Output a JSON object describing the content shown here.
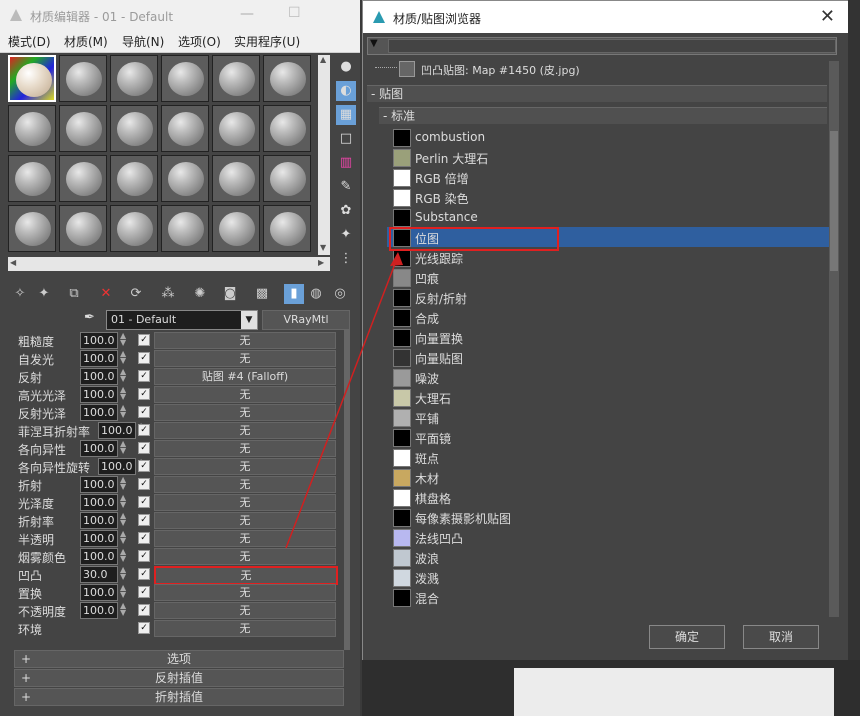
{
  "left_window": {
    "title": "材质编辑器 - 01 - Default",
    "menu": [
      "模式(D)",
      "材质(M)",
      "导航(N)",
      "选项(O)",
      "实用程序(U)"
    ],
    "material_name": "01 - Default",
    "material_type": "VRayMtl",
    "params": [
      {
        "label": "粗糙度",
        "value": "100.0",
        "map": "无"
      },
      {
        "label": "自发光",
        "value": "100.0",
        "map": "无"
      },
      {
        "label": "反射",
        "value": "100.0",
        "map": "贴图 #4 (Falloff)"
      },
      {
        "label": "高光光泽",
        "value": "100.0",
        "map": "无"
      },
      {
        "label": "反射光泽",
        "value": "100.0",
        "map": "无"
      },
      {
        "label": "菲涅耳折射率",
        "value": "100.0",
        "map": "无"
      },
      {
        "label": "各向异性",
        "value": "100.0",
        "map": "无"
      },
      {
        "label": "各向异性旋转",
        "value": "100.0",
        "map": "无"
      },
      {
        "label": "折射",
        "value": "100.0",
        "map": "无"
      },
      {
        "label": "光泽度",
        "value": "100.0",
        "map": "无"
      },
      {
        "label": "折射率",
        "value": "100.0",
        "map": "无"
      },
      {
        "label": "半透明",
        "value": "100.0",
        "map": "无"
      },
      {
        "label": "烟雾颜色",
        "value": "100.0",
        "map": "无"
      },
      {
        "label": "凹凸",
        "value": "30.0",
        "map": "无"
      },
      {
        "label": "置换",
        "value": "100.0",
        "map": "无"
      },
      {
        "label": "不透明度",
        "value": "100.0",
        "map": "无"
      },
      {
        "label": "环境",
        "value": "",
        "map": "无"
      }
    ],
    "rollouts": [
      "选项",
      "反射插值",
      "折射插值"
    ],
    "check_mark": "✓",
    "plus": "+"
  },
  "right_window": {
    "title": "材质/贴图浏览器",
    "current_map": "凹凸贴图: Map #1450 (皮.jpg)",
    "tree_maps": "- 贴图",
    "tree_standard": "- 标准",
    "items": [
      {
        "label": "combustion",
        "swatch": "#000000"
      },
      {
        "label": "Perlin 大理石",
        "swatch": "#9aa07a"
      },
      {
        "label": "RGB 倍增",
        "swatch": "#ffffff"
      },
      {
        "label": "RGB 染色",
        "swatch": "#ffffff"
      },
      {
        "label": "Substance",
        "swatch": "#000000"
      },
      {
        "label": "位图",
        "swatch": "#000000"
      },
      {
        "label": "光线跟踪",
        "swatch": "#000000"
      },
      {
        "label": "凹痕",
        "swatch": "#888888"
      },
      {
        "label": "反射/折射",
        "swatch": "#000000"
      },
      {
        "label": "合成",
        "swatch": "#000000"
      },
      {
        "label": "向量置换",
        "swatch": "#000000"
      },
      {
        "label": "向量贴图",
        "swatch": "#333333"
      },
      {
        "label": "噪波",
        "swatch": "#9a9a9a"
      },
      {
        "label": "大理石",
        "swatch": "#c8c8a8"
      },
      {
        "label": "平铺",
        "swatch": "#b0b0b0"
      },
      {
        "label": "平面镜",
        "swatch": "#000000"
      },
      {
        "label": "斑点",
        "swatch": "#ffffff"
      },
      {
        "label": "木材",
        "swatch": "#c8a860"
      },
      {
        "label": "棋盘格",
        "swatch": "#ffffff"
      },
      {
        "label": "每像素摄影机贴图",
        "swatch": "#000000"
      },
      {
        "label": "法线凹凸",
        "swatch": "#b8b8f0"
      },
      {
        "label": "波浪",
        "swatch": "#c0c8d0"
      },
      {
        "label": "泼溅",
        "swatch": "#d0d8e0"
      },
      {
        "label": "混合",
        "swatch": "#000000"
      }
    ],
    "ok": "确定",
    "cancel": "取消",
    "close": "✕"
  },
  "accent": {
    "highlight": "#e02020",
    "selection": "#2f5f9f"
  }
}
